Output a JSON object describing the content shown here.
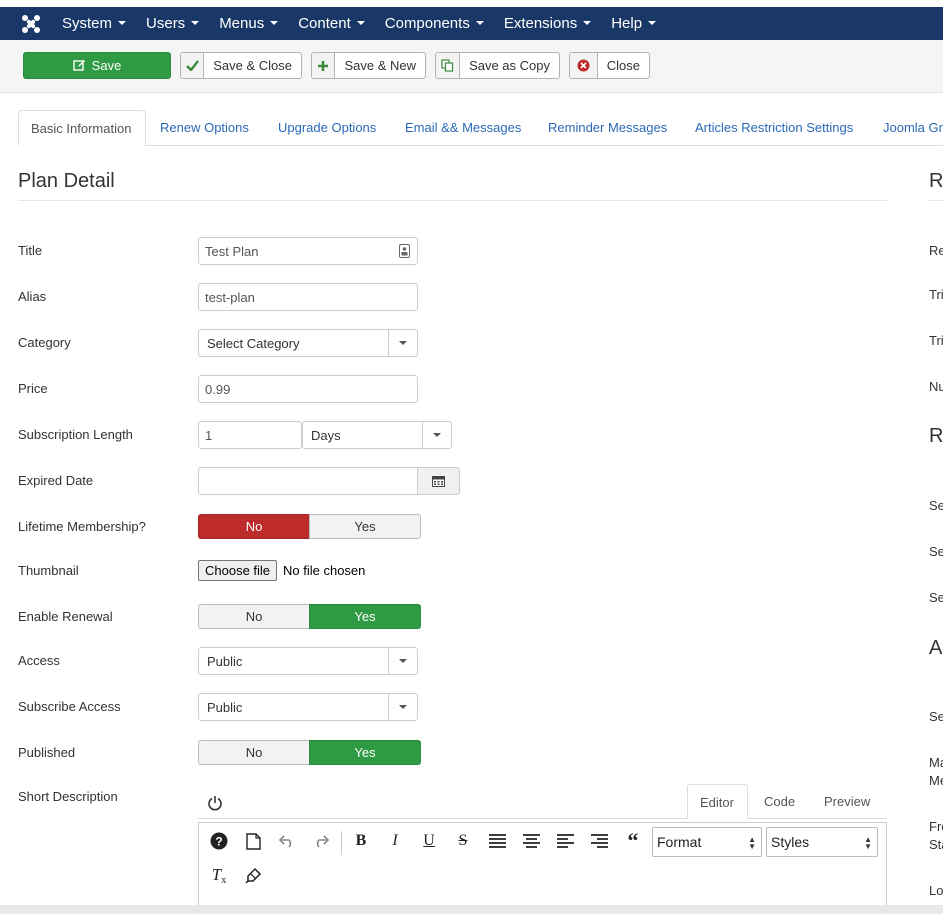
{
  "nav": {
    "items": [
      {
        "label": "System"
      },
      {
        "label": "Users"
      },
      {
        "label": "Menus"
      },
      {
        "label": "Content"
      },
      {
        "label": "Components"
      },
      {
        "label": "Extensions"
      },
      {
        "label": "Help"
      }
    ]
  },
  "toolbar": {
    "save": "Save",
    "save_close": "Save & Close",
    "save_new": "Save & New",
    "save_copy": "Save as Copy",
    "close": "Close"
  },
  "tabs": [
    "Basic Information",
    "Renew Options",
    "Upgrade Options",
    "Email && Messages",
    "Reminder Messages",
    "Articles Restriction Settings",
    "Joomla Gr"
  ],
  "section_title": "Plan Detail",
  "fields": {
    "title": {
      "label": "Title",
      "value": "Test Plan"
    },
    "alias": {
      "label": "Alias",
      "value": "test-plan"
    },
    "category": {
      "label": "Category",
      "value": "Select Category"
    },
    "price": {
      "label": "Price",
      "value": "0.99"
    },
    "subscription_length": {
      "label": "Subscription Length",
      "value": "1",
      "unit": "Days"
    },
    "expired_date": {
      "label": "Expired Date",
      "value": ""
    },
    "lifetime": {
      "label": "Lifetime Membership?",
      "no": "No",
      "yes": "Yes"
    },
    "thumbnail": {
      "label": "Thumbnail",
      "button": "Choose file",
      "status": "No file chosen"
    },
    "renewal": {
      "label": "Enable Renewal",
      "no": "No",
      "yes": "Yes"
    },
    "access": {
      "label": "Access",
      "value": "Public"
    },
    "subscribe_access": {
      "label": "Subscribe Access",
      "value": "Public"
    },
    "published": {
      "label": "Published",
      "no": "No",
      "yes": "Yes"
    },
    "short_description": {
      "label": "Short Description"
    }
  },
  "editor": {
    "tabs": [
      "Editor",
      "Code",
      "Preview"
    ],
    "format": "Format",
    "styles": "Styles"
  },
  "right_col": {
    "heads": [
      "R",
      "R",
      "Ac"
    ],
    "labels": [
      "Re",
      "Tri",
      "Tri",
      "Nu",
      "Se",
      "Se",
      "Se",
      "Se",
      "Ma",
      "Me",
      "Fre",
      "Sta",
      "Lo"
    ]
  },
  "colors": {
    "navbar": "#1a3867",
    "save": "#2f9a44",
    "no_active": "#bd2b2b",
    "yes_active": "#2f9a44",
    "link": "#2a69b8"
  }
}
